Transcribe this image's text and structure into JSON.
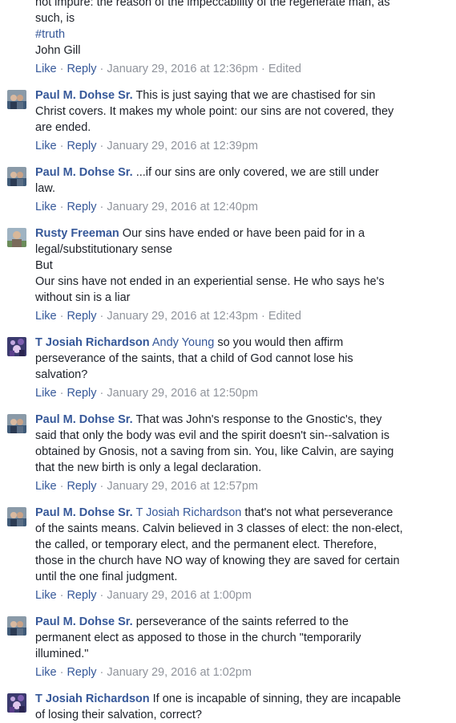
{
  "partial_top": {
    "lines": [
      "not impure: the reason of the impeccability of the regenerate man, as",
      "such, is"
    ],
    "hashtag": "#truth",
    "signature": "John Gill",
    "like": "Like",
    "reply": "Reply",
    "sep": "·",
    "timestamp": "January 29, 2016 at 12:36pm",
    "edited": "Edited"
  },
  "comments": [
    {
      "author": "Paul M. Dohse Sr.",
      "first": "This is just saying that we are chastised for sin",
      "lines": [
        "Christ covers. It makes my whole point: our sins are not covered, they",
        "are ended."
      ],
      "timestamp": "January 29, 2016 at 12:39pm"
    },
    {
      "author": "Paul M. Dohse Sr.",
      "first": "...if our sins are only covered, we are still under",
      "lines": [
        "law."
      ],
      "timestamp": "January 29, 2016 at 12:40pm"
    },
    {
      "author": "Rusty Freeman",
      "first": "Our sins have ended or have been paid for in a",
      "lines": [
        "legal/substitutionary sense",
        "But",
        "Our sins have not ended in an experiential sense. He who says he's",
        "without sin is a liar"
      ],
      "timestamp": "January 29, 2016 at 12:43pm",
      "edited": "Edited"
    },
    {
      "author": "T Josiah Richardson",
      "mention": "Andy Young",
      "first": "so you would then affirm",
      "lines": [
        "perseverance of the saints, that a child of God cannot lose his",
        "salvation?"
      ],
      "timestamp": "January 29, 2016 at 12:50pm"
    },
    {
      "author": "Paul M. Dohse Sr.",
      "first": "That was John's response to the Gnostic's, they",
      "lines": [
        "said that only the body was evil and the spirit doesn't sin--salvation is",
        "obtained by Gnosis, not a saving from sin. You, like Calvin, are saying",
        "that the new birth is only a legal declaration."
      ],
      "timestamp": "January 29, 2016 at 12:57pm"
    },
    {
      "author": "Paul M. Dohse Sr.",
      "mention": "T Josiah Richardson",
      "first": "that's not what perseverance",
      "lines": [
        "of the saints means. Calvin believed in 3 classes of elect: the non-elect,",
        "the called, or temporary elect, and the permanent elect. Therefore,",
        "those in the church have NO way of knowing they are saved for certain",
        "until the one final judgment."
      ],
      "timestamp": "January 29, 2016 at 1:00pm"
    },
    {
      "author": "Paul M. Dohse Sr.",
      "first": "perseverance of the saints referred to the",
      "lines": [
        "permanent elect as apposed to those in the church \"temporarily",
        "illumined.\""
      ],
      "timestamp": "January 29, 2016 at 1:02pm"
    },
    {
      "author": "T Josiah Richardson",
      "first": "If one is incapable of sinning, they are incapable",
      "lines": [
        "of losing their salvation, correct?"
      ],
      "timestamp": ""
    }
  ],
  "labels": {
    "like": "Like",
    "reply": "Reply",
    "sep": "·"
  },
  "colors": {
    "link": "#365899",
    "meta": "#90949c",
    "text": "#1d2129"
  }
}
